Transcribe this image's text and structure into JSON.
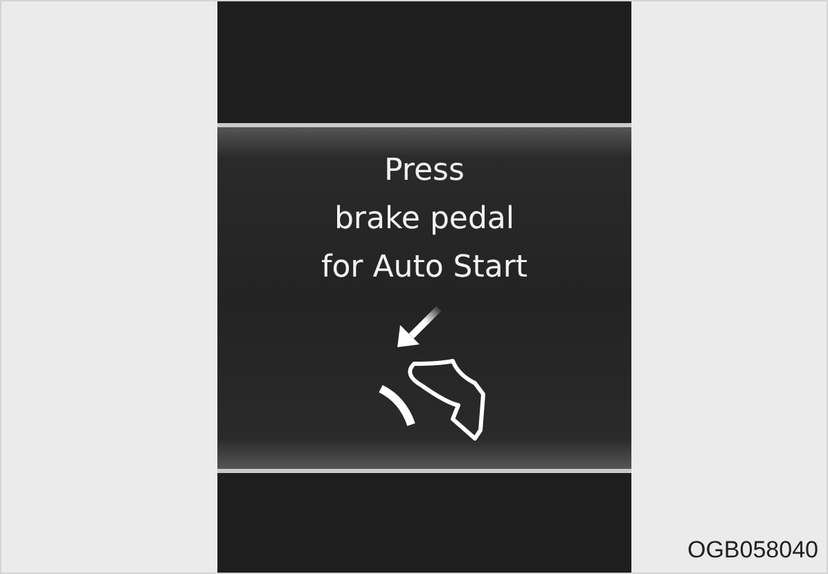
{
  "display": {
    "message_lines": [
      "Press",
      "brake pedal",
      "for Auto Start"
    ]
  },
  "figure_code": "OGB058040"
}
